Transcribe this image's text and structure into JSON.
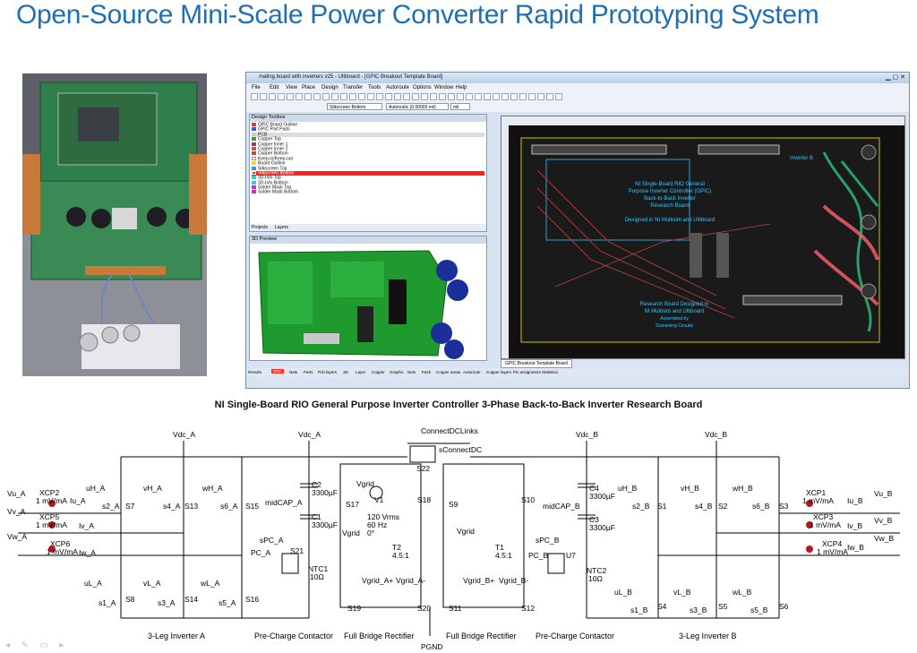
{
  "title": "Open-Source Mini-Scale Power Converter Rapid Prototyping System",
  "ultiboard": {
    "window_title": "mating board with inverters v25 - Ultiboard - [GPIC Breakout Template Board]",
    "menu": [
      "File",
      "Edit",
      "View",
      "Place",
      "Design",
      "Transfer",
      "Tools",
      "Autoroute",
      "Options",
      "Window",
      "Help"
    ],
    "layer_select": "Silkscreen Bottom",
    "grid_select": "Automatic (0.00000 mil)",
    "unit_select": "mil",
    "design_toolbox_title": "Design Toolbox",
    "layers": [
      {
        "name": "GPIC Board Outline",
        "color": "#ff2a2a"
      },
      {
        "name": "GPIC Part Pads",
        "color": "#2a5bff"
      },
      {
        "name": "PCB",
        "color": "#c9c9c9"
      },
      {
        "name": "Copper Top",
        "color": "#2ea82e"
      },
      {
        "name": "Copper Inner 1",
        "color": "#aa2ab0"
      },
      {
        "name": "Copper Inner 2",
        "color": "#b06a2a"
      },
      {
        "name": "Copper Bottom",
        "color": "#e03a3a"
      },
      {
        "name": "Keep-in/Keep-out",
        "color": "#ffffff"
      },
      {
        "name": "Board Outline",
        "color": "#ffd400"
      },
      {
        "name": "Silkscreen Top",
        "color": "#2aa0d8"
      },
      {
        "name": "Silkscreen Bottom",
        "color": "#ff2a2a"
      },
      {
        "name": "3D-Info Top",
        "color": "#2ad0d0"
      },
      {
        "name": "3D-Info Bottom",
        "color": "#2ad0d0"
      },
      {
        "name": "Solder Mask Top",
        "color": "#d02ad0"
      },
      {
        "name": "Solder Mask Bottom",
        "color": "#d02ad0"
      }
    ],
    "toolbox_tabs": [
      "Projects",
      "Layers"
    ],
    "preview_title": "3D Preview",
    "board_tab": "GPIC Breakout Template Board",
    "board_text": {
      "inverter_b": "Inverter B",
      "center_lines": [
        "NI Single-Board RIO General",
        "Purpose Inverter Controller (GPIC)",
        "Back-to-Back Inverter",
        "Research Board",
        "",
        "Designed in NI Multisim and Ultiboard"
      ],
      "bottom_lines": [
        "Research Board Designed in",
        "NI Multisim and Ultiboard",
        "Assembled by",
        "Screaming Circuits"
      ]
    },
    "bottom_tabs": [
      "Results",
      "DRC",
      "Nets",
      "Parts",
      "Pcb layers",
      "3D",
      "Layer",
      "Copper",
      "Graphic",
      "Nets",
      "Pack",
      "Copper areas",
      "Autoroute",
      "Copper layers",
      "Pin assignment",
      "Statistics"
    ]
  },
  "schematic": {
    "title": "NI Single-Board RIO General Purpose Inverter Controller 3-Phase Back-to-Back Inverter Research Board",
    "labels": {
      "vdc_a": "Vdc_A",
      "vdc_a2": "Vdc_A",
      "connectdclinks": "ConnectDCLinks",
      "sconnectdc": "sConnectDC",
      "s22": "S22",
      "vdc_b": "Vdc_B",
      "vdc_b2": "Vdc_B",
      "vu_a": "Vu_A",
      "vv_a": "Vv_A",
      "vw_a": "Vw_A",
      "iu_a": "Iu_A",
      "iv_a": "Iv_A",
      "iw_a": "Iw_A",
      "xcp2": "XCP2",
      "xcp2v": "1 mV/mA",
      "xcp5": "XCP5",
      "xcp5v": "1 mV/mA",
      "xcp6": "XCP6",
      "xcp6v": "1 mV/mA",
      "uh_a": "uH_A",
      "s2_a": "s2_A",
      "s7": "S7",
      "vh_a": "vH_A",
      "s4_a": "s4_A",
      "s13": "S13",
      "wh_a": "wH_A",
      "s6_a": "s6_A",
      "s15": "S15",
      "ul_a": "uL_A",
      "s1_a": "s1_A",
      "s8": "S8",
      "vl_a": "vL_A",
      "s3_a": "s3_A",
      "s14": "S14",
      "wl_a": "wL_A",
      "s5_a": "s5_A",
      "s16": "S16",
      "c2": "C2",
      "c2v": "3300µF",
      "midcap_a": "midCAP_A",
      "c1": "C1",
      "c1v": "3300µF",
      "spc_a": "sPC_A",
      "pc_a": "PC_A",
      "s21": "S21",
      "ntc1": "NTC1",
      "ntc1v": "10Ω",
      "vgrid": "Vgrid",
      "v1": "V1",
      "v1a": "120 Vrms",
      "v1b": "60 Hz",
      "v1c": "0°",
      "s17": "S17",
      "s18": "S18",
      "vgrid2": "Vgrid",
      "t2": "T2",
      "t2v": "4.5:1",
      "vgrid_a_plus": "Vgrid_A+",
      "vgrid_a_minus": "Vgrid_A-",
      "s19": "S19",
      "s20": "S20",
      "pgnd": "PGND",
      "s9": "S9",
      "s10": "S10",
      "vgrid3": "Vgrid",
      "t1": "T1",
      "t1v": "4.5:1",
      "vgrid_b_plus": "Vgrid_B+",
      "vgrid_b_minus": "Vgrid_B-",
      "s11": "S11",
      "s12": "S12",
      "c4": "C4",
      "c4v": "3300µF",
      "midcap_b": "midCAP_B",
      "c3": "C3",
      "c3v": "3300µF",
      "spc_b": "sPC_B",
      "pc_b": "PC_B",
      "u7": "U7",
      "ntc2": "NTC2",
      "ntc2v": "10Ω",
      "uh_b": "uH_B",
      "s2_b": "s2_B",
      "s1": "S1",
      "vh_b": "vH_B",
      "s4_b": "s4_B",
      "s2": "S2",
      "wh_b": "wH_B",
      "s6_b": "s6_B",
      "s3": "S3",
      "ul_b": "uL_B",
      "s1_b": "s1_B",
      "s4": "S4",
      "vl_b": "vL_B",
      "s3_b": "s3_B",
      "s5": "S5",
      "wl_b": "wL_B",
      "s5_b": "s5_B",
      "s6": "S6",
      "xcp1": "XCP1",
      "xcp1v": "1 mV/mA",
      "xcp3": "XCP3",
      "xcp3v": "1 mV/mA",
      "xcp4": "XCP4",
      "xcp4v": "1 mV/mA",
      "iu_b": "Iu_B",
      "iv_b": "Iv_B",
      "iw_b": "Iw_B",
      "vu_b": "Vu_B",
      "vv_b": "Vv_B",
      "vw_b": "Vw_B"
    },
    "sections": {
      "inv_a": "3-Leg Inverter A",
      "precharge_a": "Pre-Charge Contactor",
      "rect_a": "Full Bridge Rectifier",
      "rect_b": "Full Bridge Rectifier",
      "precharge_b": "Pre-Charge Contactor",
      "inv_b": "3-Leg Inverter B"
    }
  }
}
